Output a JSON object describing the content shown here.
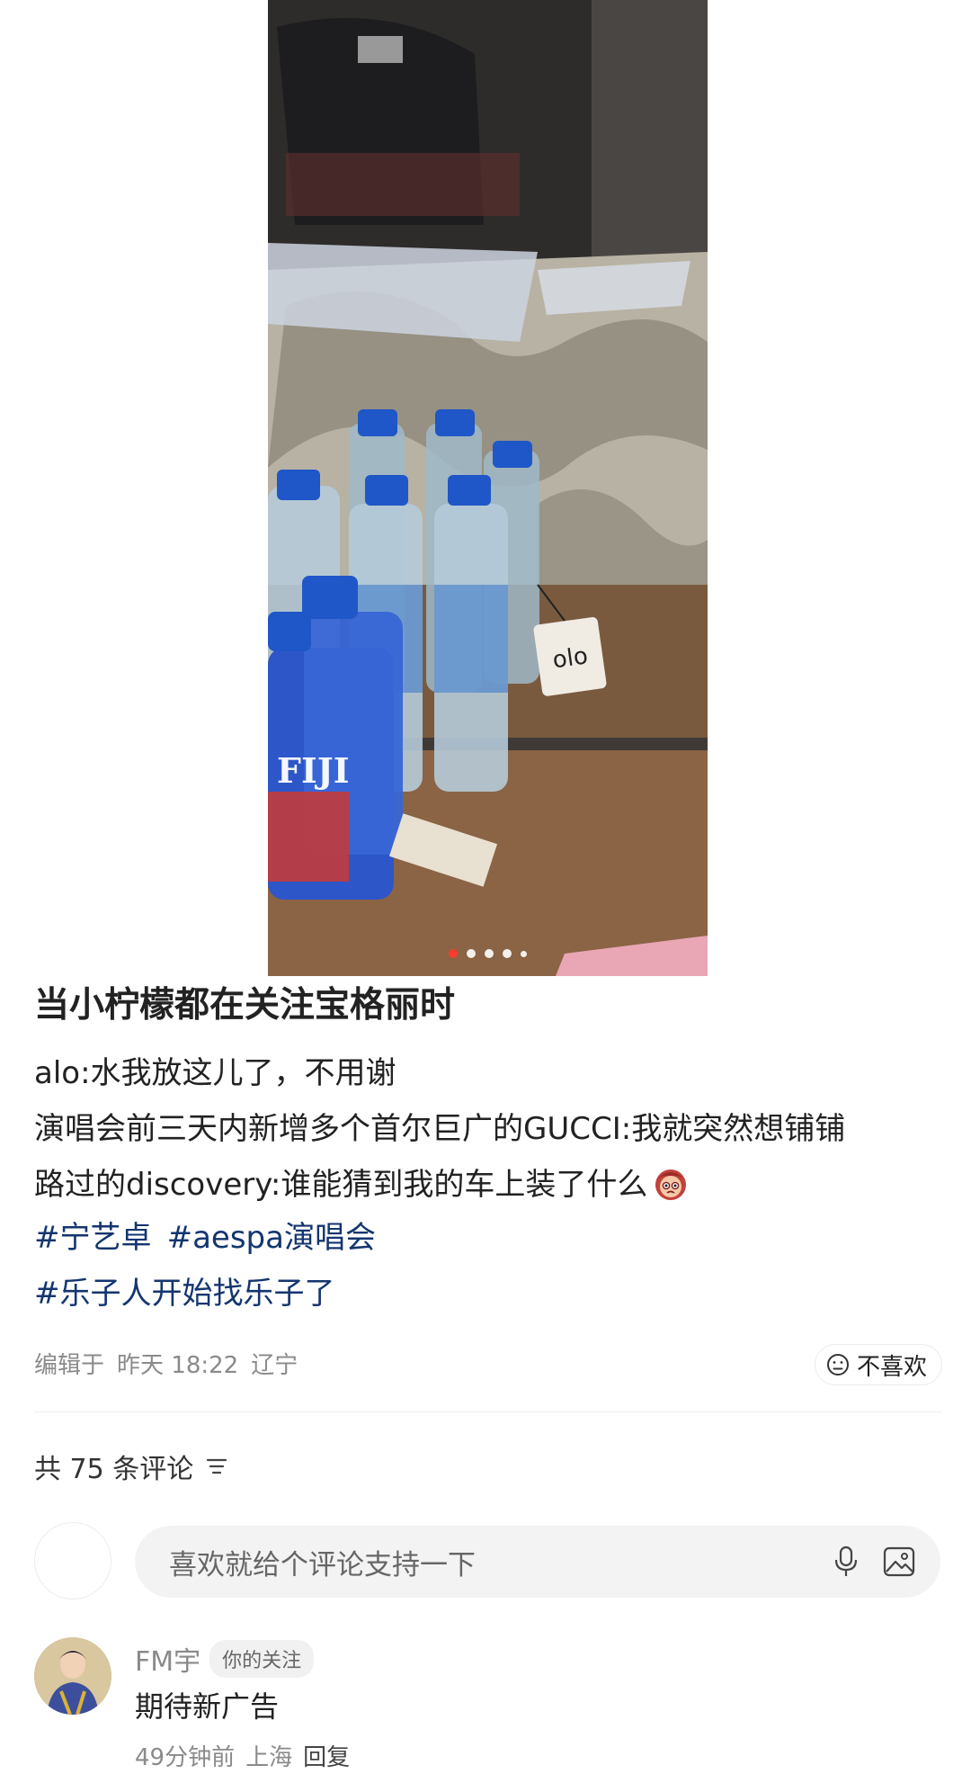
{
  "post": {
    "title": "当小柠檬都在关注宝格丽时",
    "lines": [
      "alo:水我放这儿了，不用谢",
      "演唱会前三天内新增多个首尔巨广的GUCCI:我就突然想铺铺",
      "路过的discovery:谁能猜到我的车上装了什么"
    ],
    "tags": [
      "#宁艺卓",
      "#aespa演唱会",
      "#乐子人开始找乐子了"
    ],
    "photo": {
      "tag_text": "olo",
      "bottle_brand": "FIJI",
      "image_count": 5,
      "active_index": 0
    },
    "meta": {
      "edited": "编辑于",
      "time": "昨天 18:22",
      "location": "辽宁"
    },
    "dislike_label": "不喜欢"
  },
  "comments_header": {
    "count_label": "共 75 条评论"
  },
  "comment_input": {
    "placeholder": "喜欢就给个评论支持一下"
  },
  "comments": [
    {
      "name": "FM宇",
      "badge": "你的关注",
      "text": "期待新广告",
      "time": "49分钟前",
      "location": "上海",
      "reply": "回复"
    }
  ],
  "icons": {
    "emoji": "face-emoji-icon",
    "dislike": "frown-face-icon",
    "sort": "sort-lines-icon",
    "mic": "microphone-icon",
    "image": "image-icon"
  },
  "colors": {
    "tag": "#14356f",
    "active_dot": "#ff3b30",
    "muted": "#8a8a8a"
  }
}
